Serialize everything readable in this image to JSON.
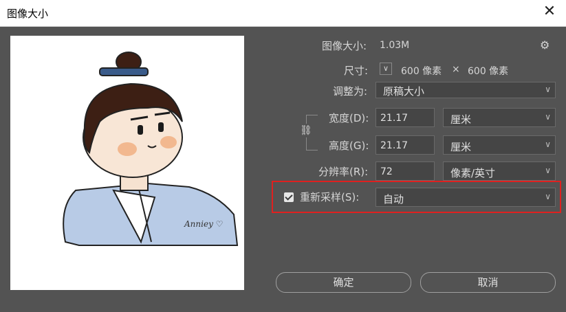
{
  "window": {
    "title": "图像大小",
    "close_glyph": "✕"
  },
  "image_size": {
    "label": "图像大小:",
    "value": "1.03M"
  },
  "dimensions": {
    "label": "尺寸:",
    "width": "600 像素",
    "times": "×",
    "height": "600 像素"
  },
  "fit_to": {
    "label": "调整为:",
    "value": "原稿大小"
  },
  "width": {
    "label": "宽度(D):",
    "value": "21.17",
    "unit": "厘米"
  },
  "height": {
    "label": "高度(G):",
    "value": "21.17",
    "unit": "厘米"
  },
  "resolution": {
    "label": "分辨率(R):",
    "value": "72",
    "unit": "像素/英寸"
  },
  "resample": {
    "label": "重新采样(S):",
    "value": "自动",
    "checked": true
  },
  "buttons": {
    "ok": "确定",
    "cancel": "取消"
  },
  "preview": {
    "signature": "Anniey ♡"
  },
  "colors": {
    "background": "#535353",
    "field": "#454545",
    "highlight": "#e0201f",
    "text": "#d6d6d6"
  }
}
